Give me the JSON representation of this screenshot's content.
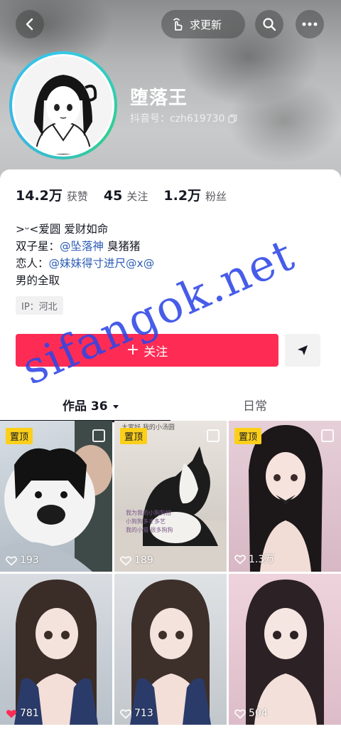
{
  "header": {
    "request_update_label": "求更新",
    "nickname": "堕落王",
    "douyin_id": "抖音号：czh619730"
  },
  "stats": [
    {
      "value": "14.2万",
      "label": "获赞"
    },
    {
      "value": "45",
      "label": "关注"
    },
    {
      "value": "1.2万",
      "label": "粉丝"
    }
  ],
  "bio": {
    "line1": ">ᵕ<爱圆 爱财如命",
    "line2_prefix": "双子星：",
    "line2_mention": "@坠落神",
    "line2_suffix": " 臭猪猪",
    "line3_prefix": "恋人：",
    "line3_mention": "@妹妹得寸进尺@x@",
    "line4": "男的全取"
  },
  "ip_tag": "IP：河北",
  "follow_label": "关注",
  "tabs": {
    "works": "作品 36",
    "daily": "日常"
  },
  "videos": [
    {
      "pinned": true,
      "pin_label": "置顶",
      "likes": "193"
    },
    {
      "pinned": true,
      "pin_label": "置顶",
      "likes": "189"
    },
    {
      "pinned": true,
      "pin_label": "置顶",
      "likes": "1.3万"
    },
    {
      "pinned": false,
      "likes": "781",
      "liked": true
    },
    {
      "pinned": false,
      "likes": "713"
    },
    {
      "pinned": false,
      "likes": "504"
    }
  ],
  "watermark": "sifangok.net",
  "colors": {
    "follow": "#fe2c55",
    "mention": "#2b5bb5",
    "pin": "#fbcf1a",
    "watermark": "#2d46e6"
  }
}
